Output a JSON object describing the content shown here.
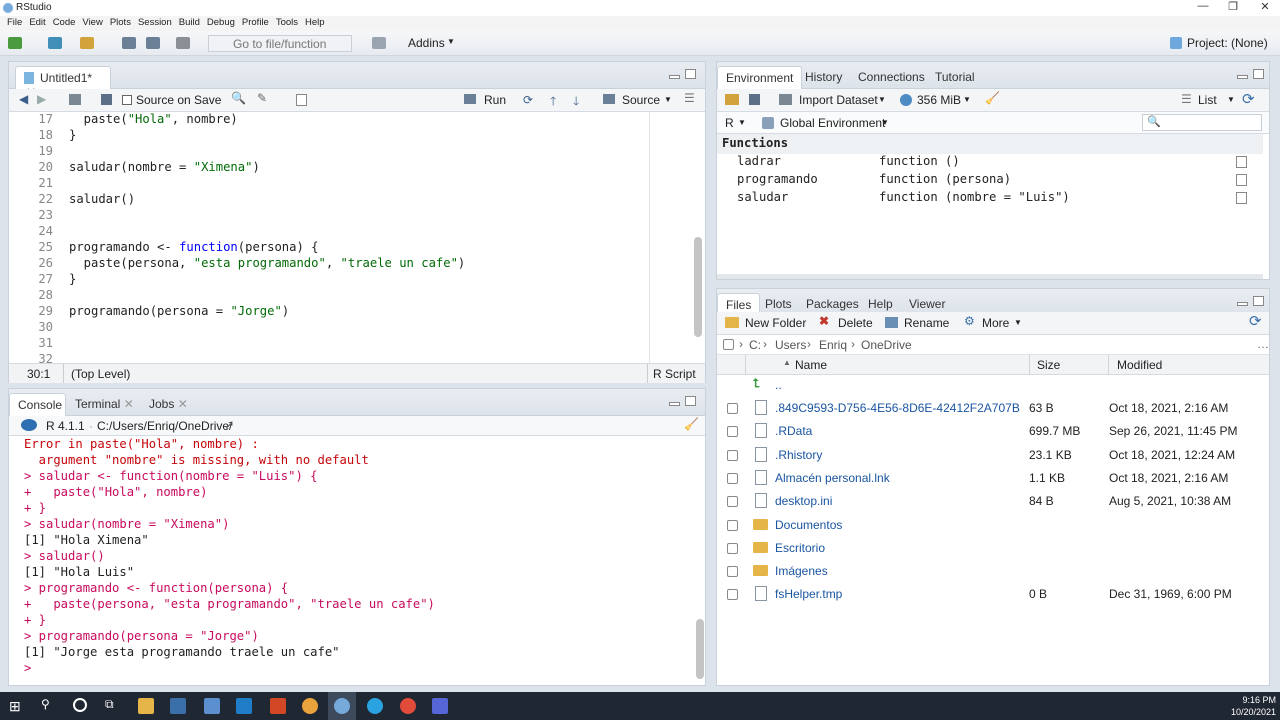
{
  "window": {
    "title": "RStudio"
  },
  "menu": [
    "File",
    "Edit",
    "Code",
    "View",
    "Plots",
    "Session",
    "Build",
    "Debug",
    "Profile",
    "Tools",
    "Help"
  ],
  "toolbar": {
    "goto_placeholder": "Go to file/function",
    "addins": "Addins",
    "project": "Project: (None)"
  },
  "editor": {
    "tab": "Untitled1*",
    "source_on_save": "Source on Save",
    "run": "Run",
    "source": "Source",
    "lines": [
      {
        "n": "17",
        "code": "  paste(\"Hola\", nombre)"
      },
      {
        "n": "18",
        "code": "}"
      },
      {
        "n": "19",
        "code": ""
      },
      {
        "n": "20",
        "code": "saludar(nombre = \"Ximena\")"
      },
      {
        "n": "21",
        "code": ""
      },
      {
        "n": "22",
        "code": "saludar()"
      },
      {
        "n": "23",
        "code": ""
      },
      {
        "n": "24",
        "code": ""
      },
      {
        "n": "25",
        "code": "programando <- function(persona) {"
      },
      {
        "n": "26",
        "code": "  paste(persona, \"esta programando\", \"traele un cafe\")"
      },
      {
        "n": "27",
        "code": "}"
      },
      {
        "n": "28",
        "code": ""
      },
      {
        "n": "29",
        "code": "programando(persona = \"Jorge\")"
      },
      {
        "n": "30",
        "code": ""
      },
      {
        "n": "31",
        "code": ""
      },
      {
        "n": "32",
        "code": ""
      }
    ],
    "status_pos": "30:1",
    "status_scope": "(Top Level)",
    "status_type": "R Script"
  },
  "console": {
    "tabs": [
      "Console",
      "Terminal",
      "Jobs"
    ],
    "version": "R 4.1.1",
    "path": "C:/Users/Enriq/OneDrive/",
    "lines": [
      {
        "t": "Error in paste(\"Hola\", nombre) :",
        "c": "err"
      },
      {
        "t": "  argument \"nombre\" is missing, with no default",
        "c": "err"
      },
      {
        "t": "> saludar <- function(nombre = \"Luis\") {",
        "c": "pink"
      },
      {
        "t": "+   paste(\"Hola\", nombre)",
        "c": "pink"
      },
      {
        "t": "+ }",
        "c": "pink"
      },
      {
        "t": "> saludar(nombre = \"Ximena\")",
        "c": "pink"
      },
      {
        "t": "[1] \"Hola Ximena\"",
        "c": "out"
      },
      {
        "t": "> saludar()",
        "c": "pink"
      },
      {
        "t": "[1] \"Hola Luis\"",
        "c": "out"
      },
      {
        "t": "> programando <- function(persona) {",
        "c": "pink"
      },
      {
        "t": "+   paste(persona, \"esta programando\", \"traele un cafe\")",
        "c": "pink"
      },
      {
        "t": "+ }",
        "c": "pink"
      },
      {
        "t": "> programando(persona = \"Jorge\")",
        "c": "pink"
      },
      {
        "t": "[1] \"Jorge esta programando traele un cafe\"",
        "c": "out"
      },
      {
        "t": "> ",
        "c": "pink"
      }
    ]
  },
  "environment": {
    "tabs": [
      "Environment",
      "History",
      "Connections",
      "Tutorial"
    ],
    "import": "Import Dataset",
    "mem": "356 MiB",
    "view": "List",
    "lang": "R",
    "scope": "Global Environment",
    "section": "Functions",
    "items": [
      {
        "name": "ladrar",
        "value": "function ()"
      },
      {
        "name": "programando",
        "value": "function (persona)"
      },
      {
        "name": "saludar",
        "value": "function (nombre = \"Luis\")"
      }
    ]
  },
  "files": {
    "tabs": [
      "Files",
      "Plots",
      "Packages",
      "Help",
      "Viewer"
    ],
    "new_folder": "New Folder",
    "delete": "Delete",
    "rename": "Rename",
    "more": "More",
    "crumbs": [
      "C:",
      "Users",
      "Enriq",
      "OneDrive"
    ],
    "cols": {
      "name": "Name",
      "size": "Size",
      "modified": "Modified"
    },
    "up": "..",
    "rows": [
      {
        "name": ".849C9593-D756-4E56-8D6E-42412F2A707B",
        "size": "63 B",
        "mod": "Oct 18, 2021, 2:16 AM",
        "kind": "file"
      },
      {
        "name": ".RData",
        "size": "699.7 MB",
        "mod": "Sep 26, 2021, 11:45 PM",
        "kind": "file"
      },
      {
        "name": ".Rhistory",
        "size": "23.1 KB",
        "mod": "Oct 18, 2021, 12:24 AM",
        "kind": "file"
      },
      {
        "name": "Almacén personal.lnk",
        "size": "1.1 KB",
        "mod": "Oct 18, 2021, 2:16 AM",
        "kind": "file"
      },
      {
        "name": "desktop.ini",
        "size": "84 B",
        "mod": "Aug 5, 2021, 10:38 AM",
        "kind": "file"
      },
      {
        "name": "Documentos",
        "size": "",
        "mod": "",
        "kind": "folder"
      },
      {
        "name": "Escritorio",
        "size": "",
        "mod": "",
        "kind": "folder"
      },
      {
        "name": "Imágenes",
        "size": "",
        "mod": "",
        "kind": "folder"
      },
      {
        "name": "fsHelper.tmp",
        "size": "0 B",
        "mod": "Dec 31, 1969, 6:00 PM",
        "kind": "file"
      }
    ]
  },
  "taskbar": {
    "time": "9:16 PM",
    "date": "10/20/2021"
  }
}
